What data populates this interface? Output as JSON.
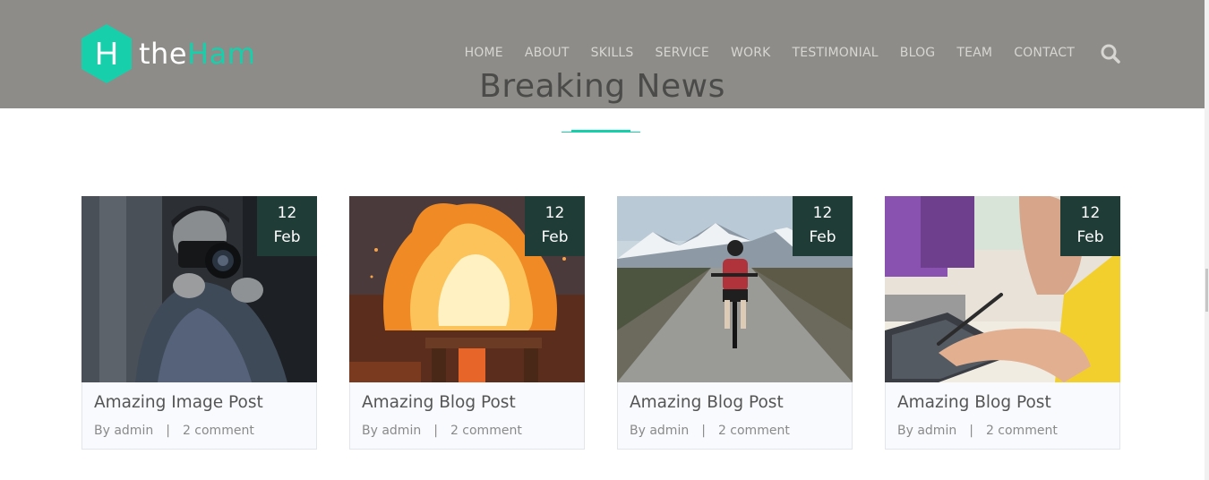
{
  "logo": {
    "letter": "H",
    "the": "the",
    "ham": "Ham"
  },
  "nav": {
    "items": [
      "HOME",
      "ABOUT",
      "SKILLS",
      "SERVICE",
      "WORK",
      "TESTIMONIAL",
      "BLOG",
      "TEAM",
      "CONTACT"
    ]
  },
  "section": {
    "title": "Breaking News"
  },
  "posts": [
    {
      "title": "Amazing Image Post",
      "author": "By admin",
      "separator": "|",
      "comments": "2 comment",
      "day": "12",
      "month": "Feb",
      "image": "photographer"
    },
    {
      "title": "Amazing Blog Post",
      "author": "By admin",
      "separator": "|",
      "comments": "2 comment",
      "day": "12",
      "month": "Feb",
      "image": "fire"
    },
    {
      "title": "Amazing Blog Post",
      "author": "By admin",
      "separator": "|",
      "comments": "2 comment",
      "day": "12",
      "month": "Feb",
      "image": "cyclist"
    },
    {
      "title": "Amazing Blog Post",
      "author": "By admin",
      "separator": "|",
      "comments": "2 comment",
      "day": "12",
      "month": "Feb",
      "image": "drawing-tablet"
    }
  ],
  "colors": {
    "header": "#8e8c88",
    "accent": "#18cfab",
    "badge": "#1f3c37",
    "card": "#f8fafd"
  }
}
